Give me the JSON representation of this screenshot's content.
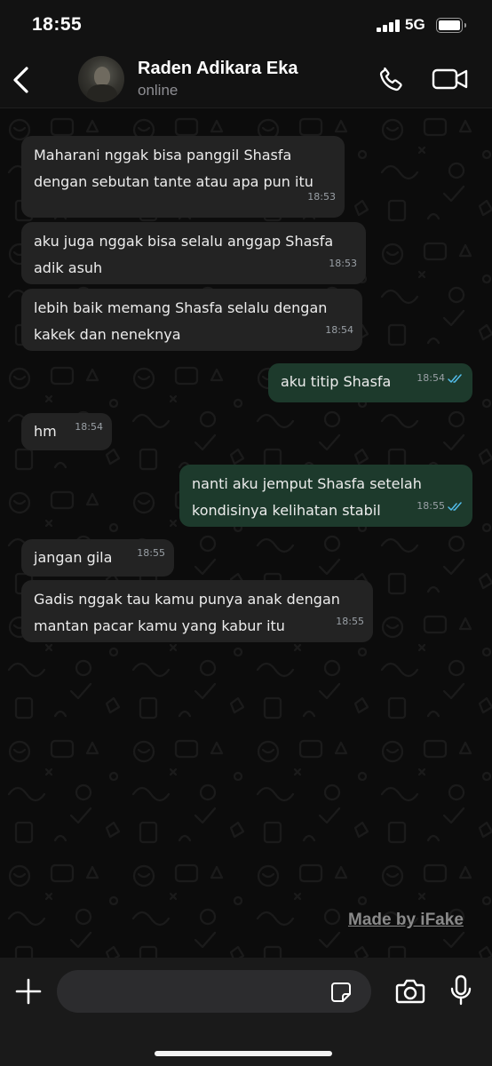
{
  "status_bar": {
    "time": "18:55",
    "network": "5G",
    "icons": [
      "signal-bars-icon",
      "battery-icon"
    ]
  },
  "header": {
    "contact_name": "Raden Adikara Eka",
    "contact_status": "online",
    "icons": [
      "back-chevron-icon",
      "phone-icon",
      "video-camera-icon"
    ]
  },
  "messages": [
    {
      "direction": "incoming",
      "text": "Maharani nggak bisa panggil Shasfa\ndengan sebutan tante atau apa pun itu",
      "time": "18:53"
    },
    {
      "direction": "incoming",
      "text": "aku juga nggak bisa selalu anggap Shasfa\nadik asuh",
      "time": "18:53"
    },
    {
      "direction": "incoming",
      "text": "lebih baik memang Shasfa selalu dengan\nkakek dan neneknya",
      "time": "18:54"
    },
    {
      "direction": "outgoing",
      "text": "aku titip Shasfa",
      "time": "18:54",
      "read": true
    },
    {
      "direction": "incoming",
      "text": "hm",
      "time": "18:54"
    },
    {
      "direction": "outgoing",
      "text": "nanti aku jemput Shasfa setelah\nkondisinya kelihatan stabil",
      "time": "18:55",
      "read": true
    },
    {
      "direction": "incoming",
      "text": "jangan gila",
      "time": "18:55"
    },
    {
      "direction": "incoming",
      "text": "Gadis nggak tau kamu punya anak dengan\nmantan pacar kamu yang kabur itu",
      "time": "18:55"
    }
  ],
  "watermark": "Made by iFake",
  "input_bar": {
    "placeholder": "",
    "value": "",
    "icons": [
      "plus-icon",
      "sticker-icon",
      "camera-icon",
      "microphone-icon"
    ]
  },
  "colors": {
    "incoming_bubble": "#232323",
    "outgoing_bubble": "#1d3a2c",
    "read_ticks": "#53bdeb",
    "background": "#0c0c0c"
  }
}
